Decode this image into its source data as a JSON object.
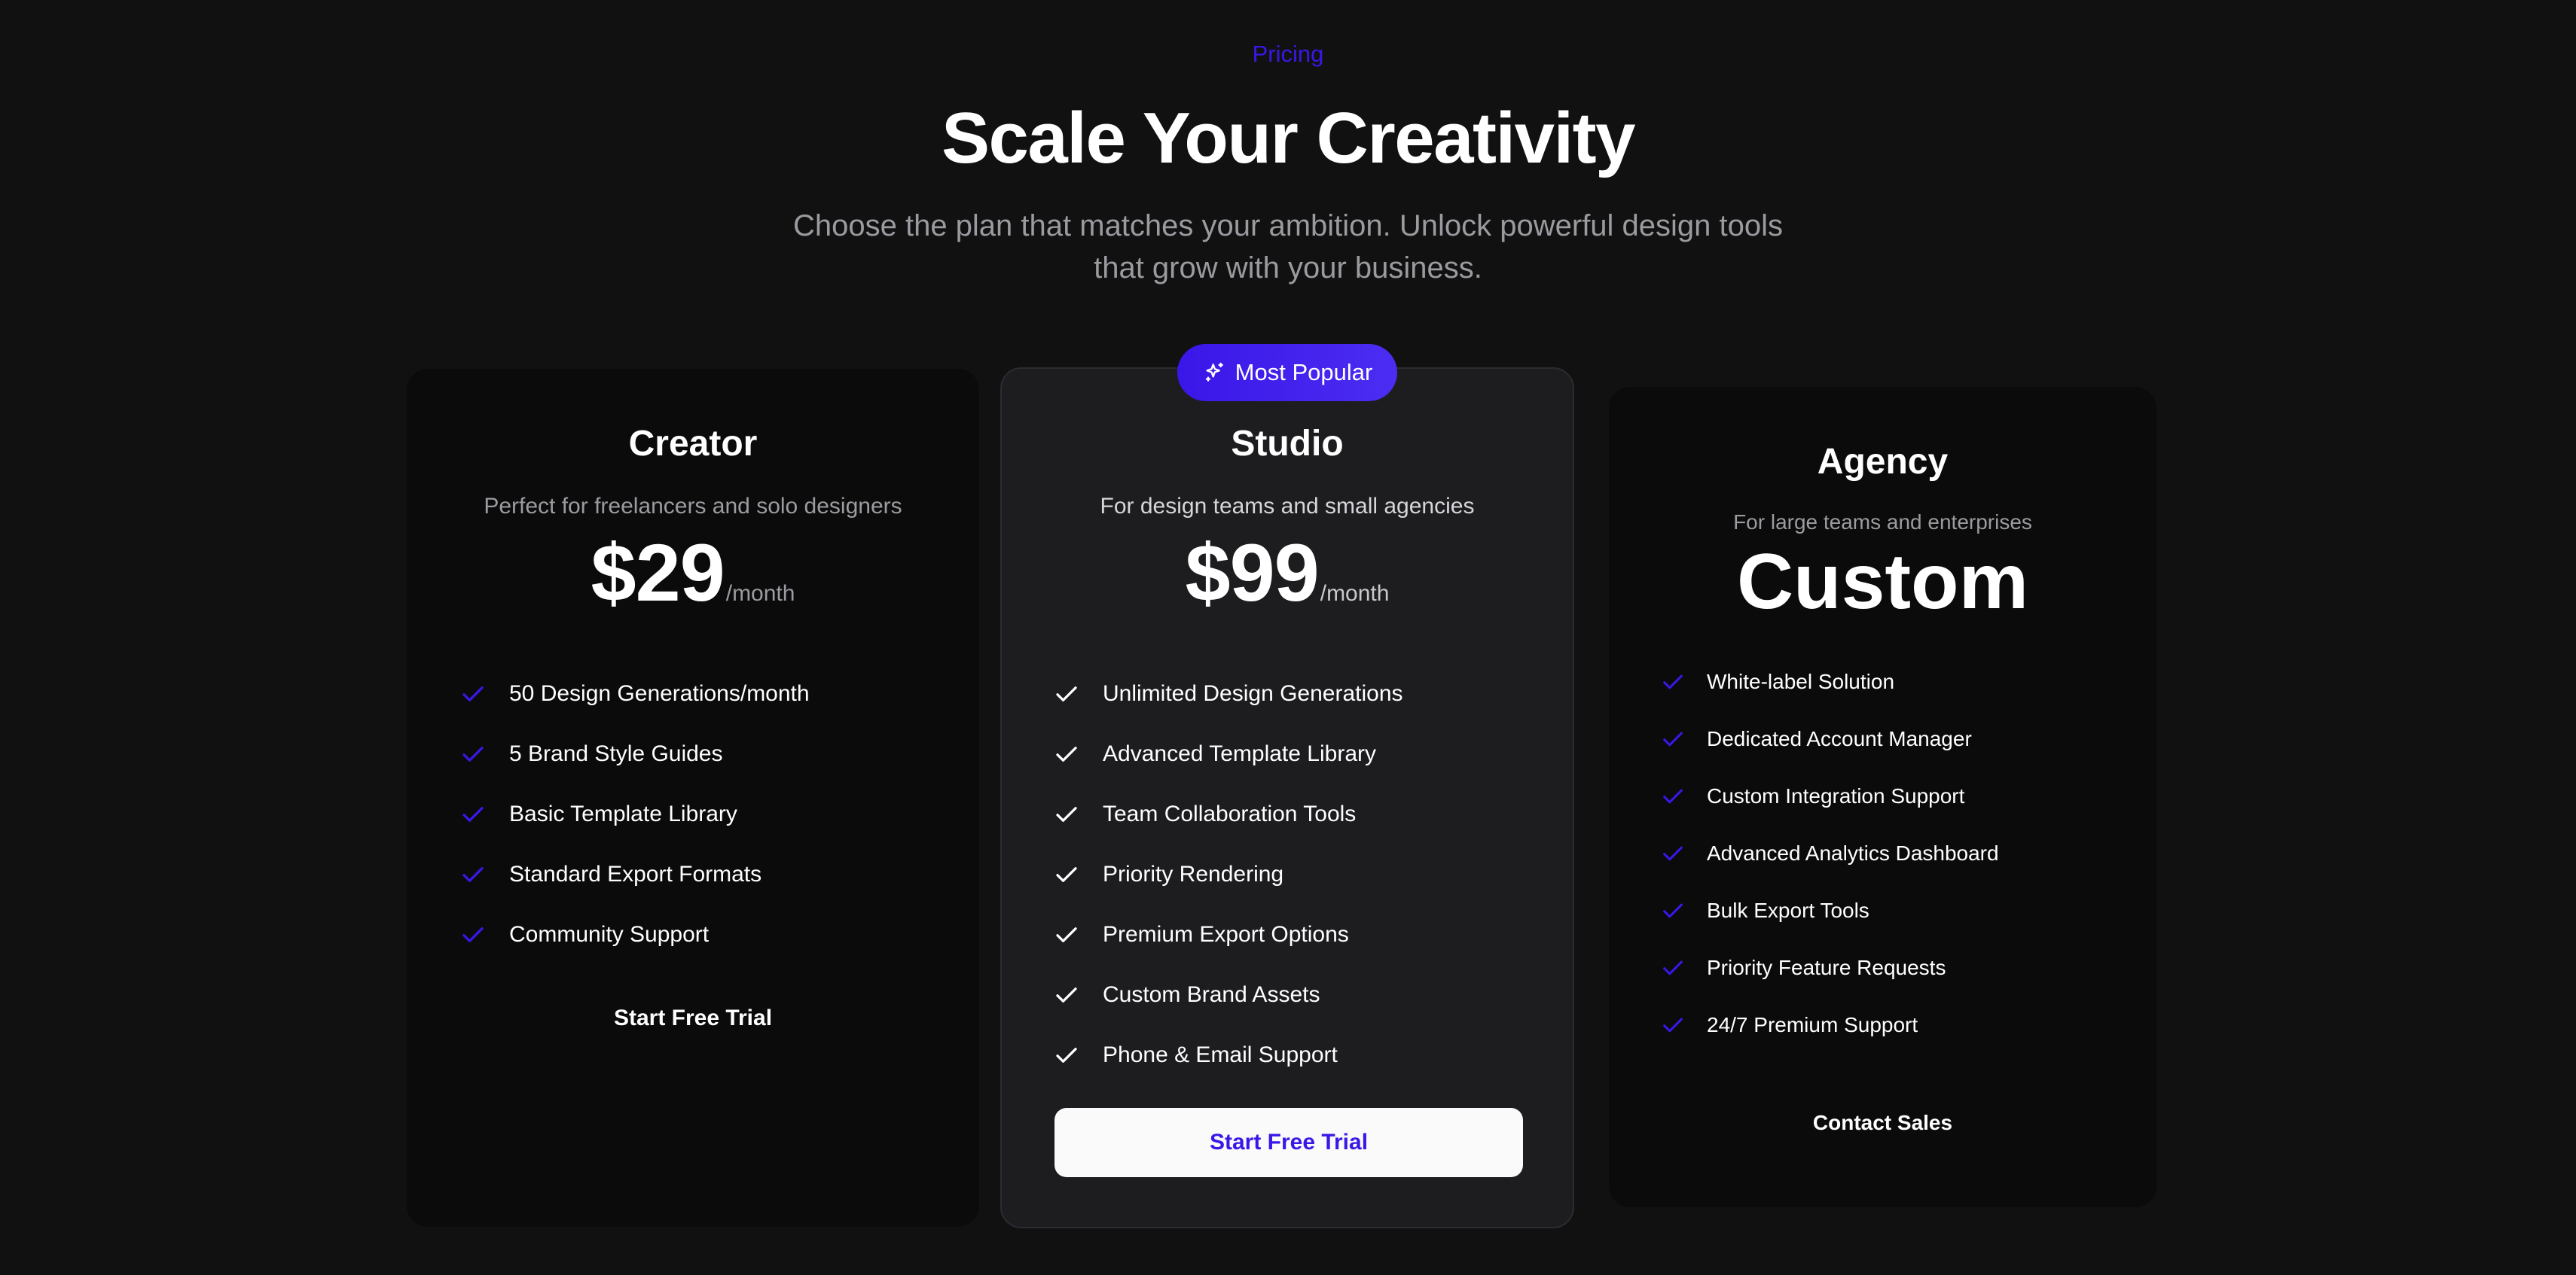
{
  "header": {
    "eyebrow": "Pricing",
    "title": "Scale Your Creativity",
    "subtitle_line1": "Choose the plan that matches your ambition. Unlock powerful design tools",
    "subtitle_line2": "that grow with your business."
  },
  "plans": [
    {
      "name": "Creator",
      "description": "Perfect for freelancers and solo designers",
      "price": "$29",
      "period": "/month",
      "features": [
        "50 Design Generations/month",
        "5 Brand Style Guides",
        "Basic Template Library",
        "Standard Export Formats",
        "Community Support"
      ],
      "cta": "Start Free Trial"
    },
    {
      "name": "Studio",
      "badge": "Most Popular",
      "badge_icon": "sparkles-icon",
      "description": "For design teams and small agencies",
      "price": "$99",
      "period": "/month",
      "features": [
        "Unlimited Design Generations",
        "Advanced Template Library",
        "Team Collaboration Tools",
        "Priority Rendering",
        "Premium Export Options",
        "Custom Brand Assets",
        "Phone & Email Support"
      ],
      "cta": "Start Free Trial"
    },
    {
      "name": "Agency",
      "description": "For large teams and enterprises",
      "price": "Custom",
      "features": [
        "White-label Solution",
        "Dedicated Account Manager",
        "Custom Integration Support",
        "Advanced Analytics Dashboard",
        "Bulk Export Tools",
        "Priority Feature Requests",
        "24/7 Premium Support"
      ],
      "cta": "Contact Sales"
    }
  ],
  "colors": {
    "background": "#111112",
    "accent": "#3a17e6",
    "featured_card": "#1d1d20",
    "card": "#0b0b0c",
    "muted_text": "#9b9ba0"
  },
  "icons": {
    "feature": "check-icon",
    "badge": "sparkles-icon"
  }
}
